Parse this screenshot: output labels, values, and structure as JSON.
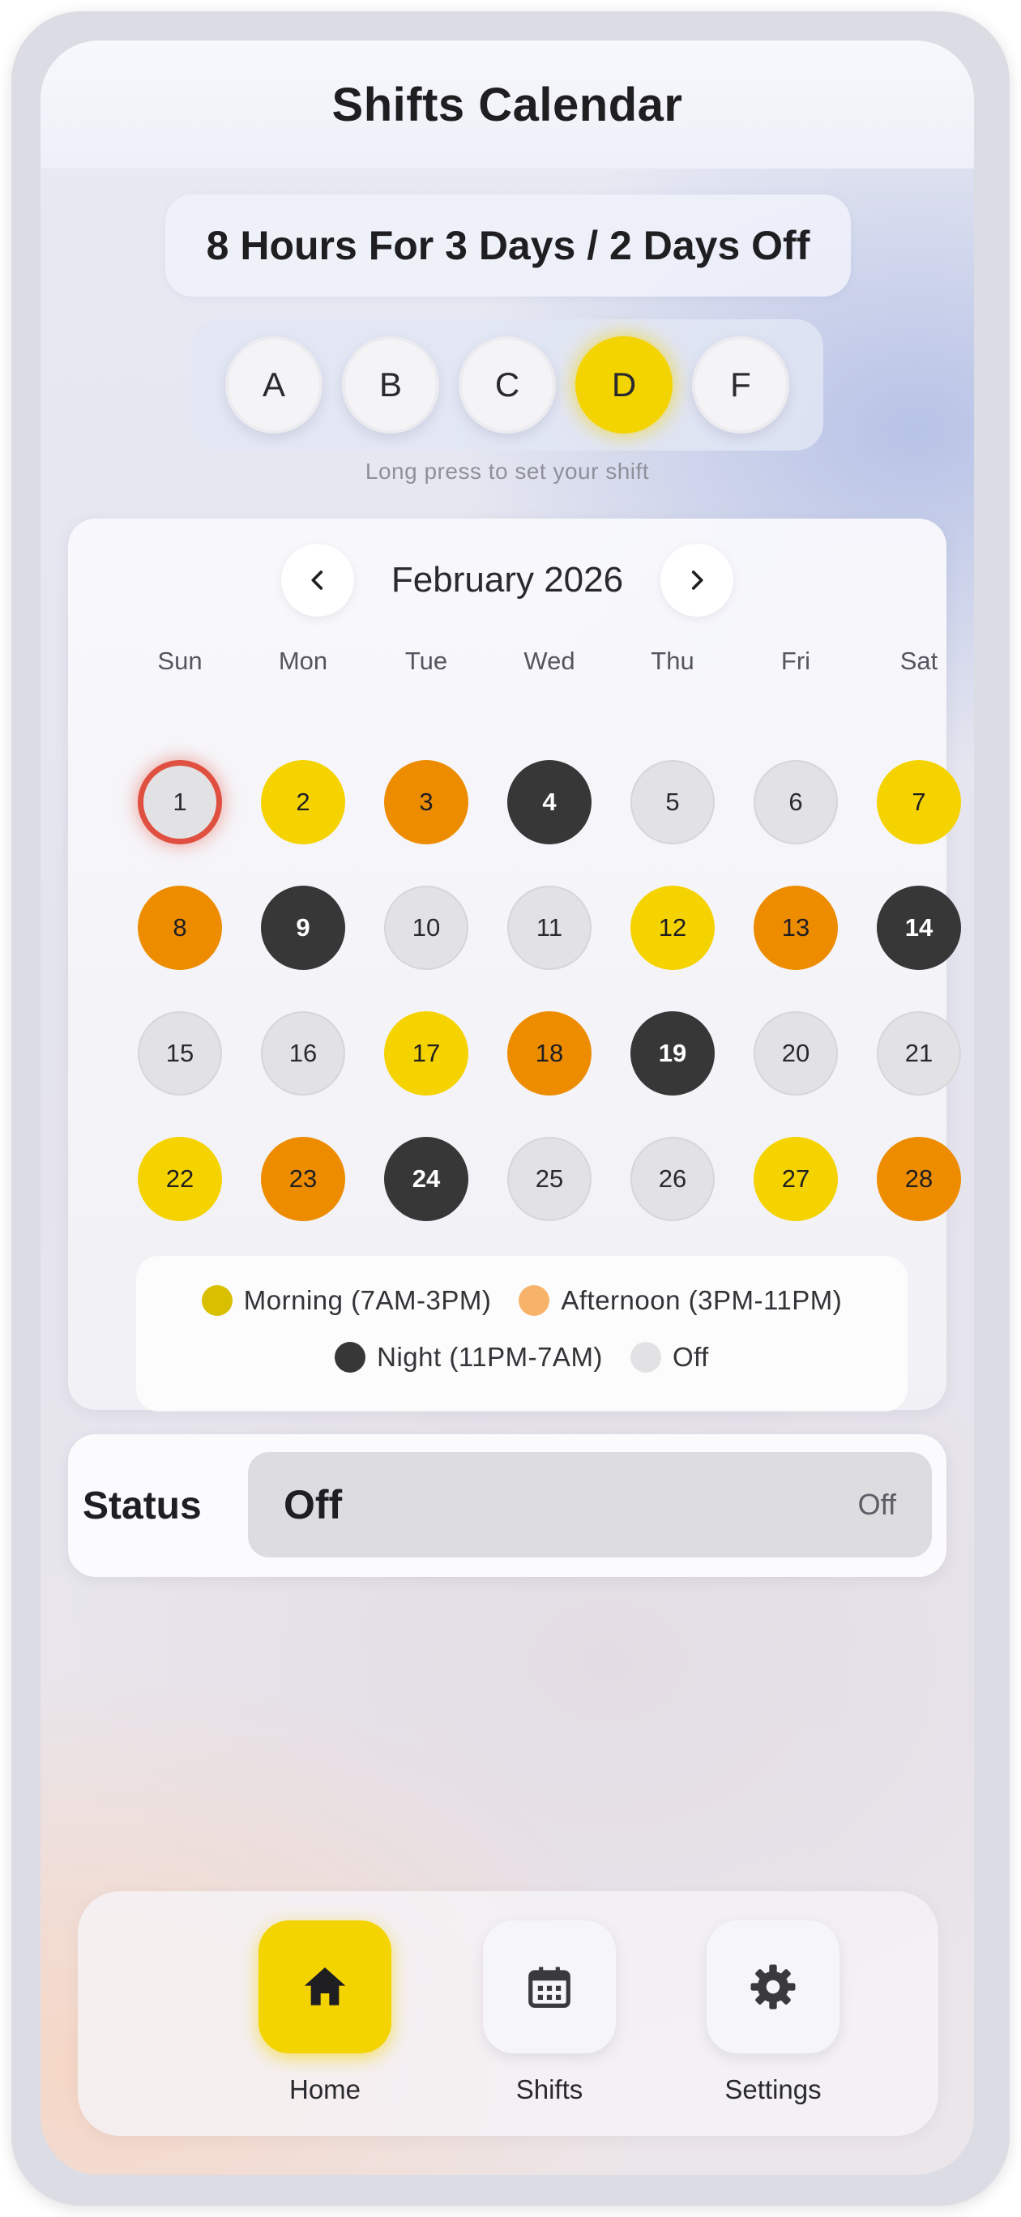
{
  "header": {
    "title": "Shifts Calendar"
  },
  "pattern": {
    "label": "8 Hours For 3 Days / 2 Days Off"
  },
  "shift_selector": {
    "options": [
      {
        "label": "A",
        "active": false
      },
      {
        "label": "B",
        "active": false
      },
      {
        "label": "C",
        "active": false
      },
      {
        "label": "D",
        "active": true
      },
      {
        "label": "F",
        "active": false
      }
    ],
    "hint": "Long press to set your shift"
  },
  "calendar": {
    "month_label": "February 2026",
    "prev_icon": "chevron-left-icon",
    "next_icon": "chevron-right-icon",
    "weekdays": [
      "Sun",
      "Mon",
      "Tue",
      "Wed",
      "Thu",
      "Fri",
      "Sat"
    ],
    "today": 1,
    "days": [
      {
        "day": "1",
        "type": "off"
      },
      {
        "day": "2",
        "type": "morning"
      },
      {
        "day": "3",
        "type": "afternoon"
      },
      {
        "day": "4",
        "type": "night"
      },
      {
        "day": "5",
        "type": "off"
      },
      {
        "day": "6",
        "type": "off"
      },
      {
        "day": "7",
        "type": "morning"
      },
      {
        "day": "8",
        "type": "afternoon"
      },
      {
        "day": "9",
        "type": "night"
      },
      {
        "day": "10",
        "type": "off"
      },
      {
        "day": "11",
        "type": "off"
      },
      {
        "day": "12",
        "type": "morning"
      },
      {
        "day": "13",
        "type": "afternoon"
      },
      {
        "day": "14",
        "type": "night"
      },
      {
        "day": "15",
        "type": "off"
      },
      {
        "day": "16",
        "type": "off"
      },
      {
        "day": "17",
        "type": "morning"
      },
      {
        "day": "18",
        "type": "afternoon"
      },
      {
        "day": "19",
        "type": "night"
      },
      {
        "day": "20",
        "type": "off"
      },
      {
        "day": "21",
        "type": "off"
      },
      {
        "day": "22",
        "type": "morning"
      },
      {
        "day": "23",
        "type": "afternoon"
      },
      {
        "day": "24",
        "type": "night"
      },
      {
        "day": "25",
        "type": "off"
      },
      {
        "day": "26",
        "type": "off"
      },
      {
        "day": "27",
        "type": "morning"
      },
      {
        "day": "28",
        "type": "afternoon"
      }
    ],
    "legend": {
      "morning": "Morning (7AM-3PM)",
      "afternoon": "Afternoon (3PM-11PM)",
      "night": "Night (11PM-7AM)",
      "off": "Off"
    }
  },
  "colors": {
    "morning": "#f5d300",
    "afternoon": "#ee8c00",
    "night": "#373737",
    "off": "#e2e2e4",
    "legend_morning": "#d8c000",
    "legend_afternoon": "#f7b36a",
    "today_ring": "#e05040",
    "accent": "#f4d400"
  },
  "status": {
    "label": "Status",
    "value": "Off",
    "tag": "Off"
  },
  "bottom_nav": {
    "items": [
      {
        "label": "Home",
        "icon": "home-icon",
        "active": true
      },
      {
        "label": "Shifts",
        "icon": "calendar-icon",
        "active": false
      },
      {
        "label": "Settings",
        "icon": "gear-icon",
        "active": false
      }
    ]
  }
}
